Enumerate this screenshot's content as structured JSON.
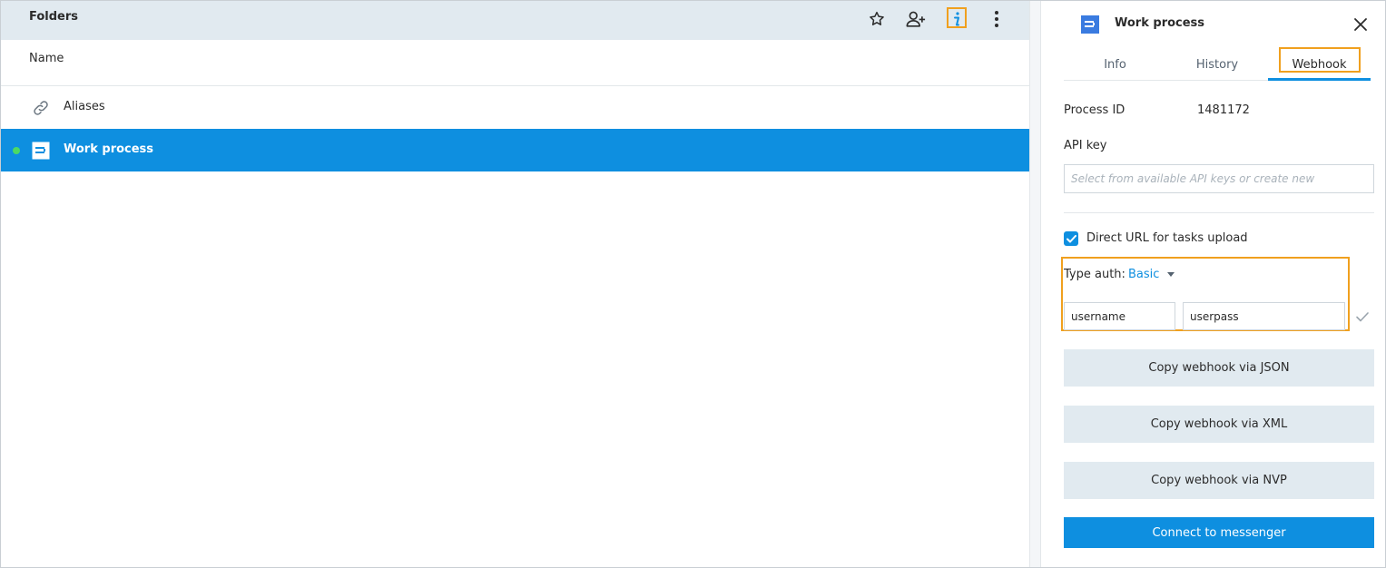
{
  "left_pane": {
    "title": "Folders",
    "toolbar": {
      "favorite_icon": "star-icon",
      "add_user_icon": "add-user-icon",
      "info_icon": "info-icon",
      "more_icon": "more-vertical-icon"
    },
    "column_header": "Name",
    "rows": [
      {
        "label": "Aliases",
        "icon": "link-icon",
        "selected": false
      },
      {
        "label": "Work process",
        "icon": "process-icon",
        "selected": true
      }
    ]
  },
  "right_pane": {
    "title": "Work process",
    "tabs": [
      {
        "label": "Info",
        "active": false
      },
      {
        "label": "History",
        "active": false
      },
      {
        "label": "Webhook",
        "active": true
      }
    ],
    "process_id_label": "Process ID",
    "process_id_value": "1481172",
    "api_key_label": "API key",
    "api_key_placeholder": "Select from available API keys or create new",
    "direct_url_label": "Direct URL for tasks upload",
    "direct_url_checked": true,
    "type_auth_label": "Type auth:",
    "type_auth_value": "Basic",
    "username_value": "username",
    "password_value": "userpass",
    "buttons": {
      "json": "Copy webhook via JSON",
      "xml": "Copy webhook via XML",
      "nvp": "Copy webhook via NVP",
      "messenger": "Connect to messenger"
    }
  },
  "colors": {
    "accent": "#0e8fe0",
    "highlight": "#f0a01e",
    "header_bg": "#e1eaf0",
    "status_dot": "#4cd964"
  }
}
